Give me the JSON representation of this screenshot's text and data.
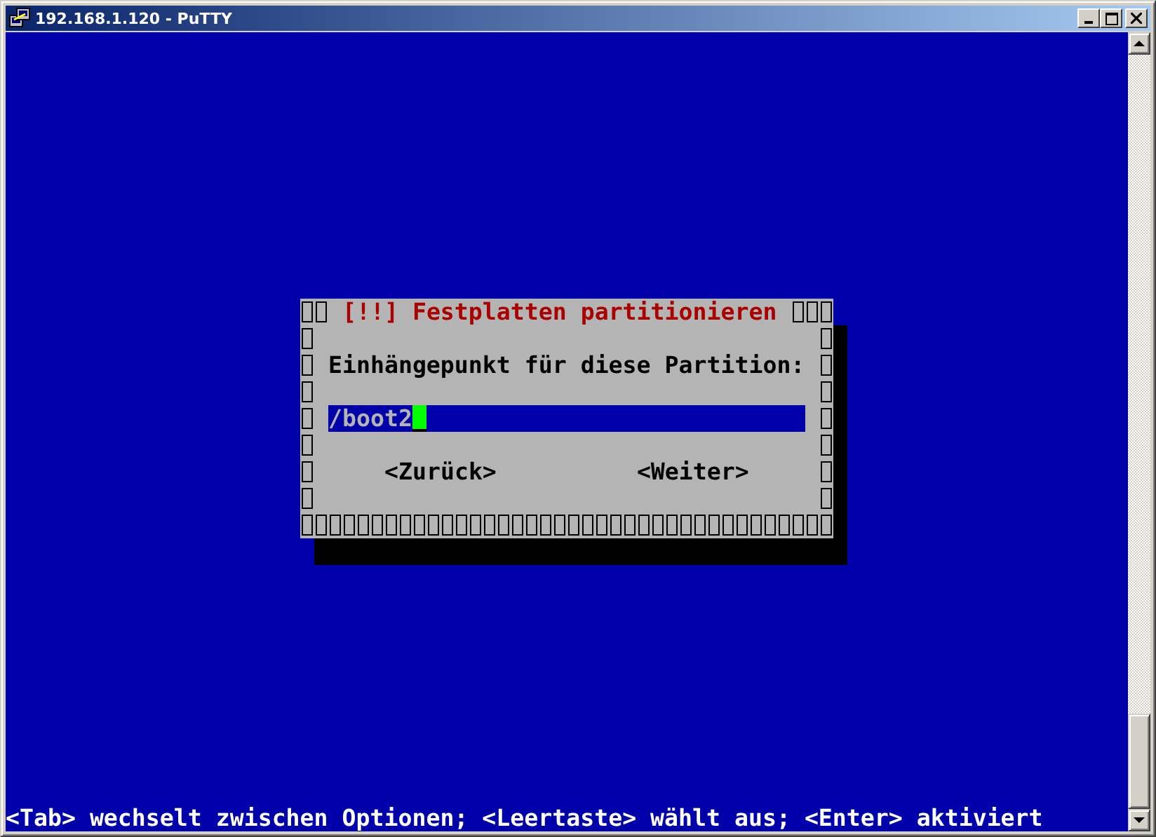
{
  "window": {
    "title": "192.168.1.120 - PuTTY"
  },
  "dialog": {
    "title": "[!!] Festplatten partitionieren",
    "prompt": "Einhängepunkt für diese Partition:",
    "field": {
      "value": "/boot2",
      "focused": true
    },
    "buttons": [
      "<Zurück>",
      "<Weiter>"
    ]
  },
  "status_line": "<Tab> wechselt zwischen Optionen; <Leertaste> wählt aus; <Enter> aktiviert"
}
